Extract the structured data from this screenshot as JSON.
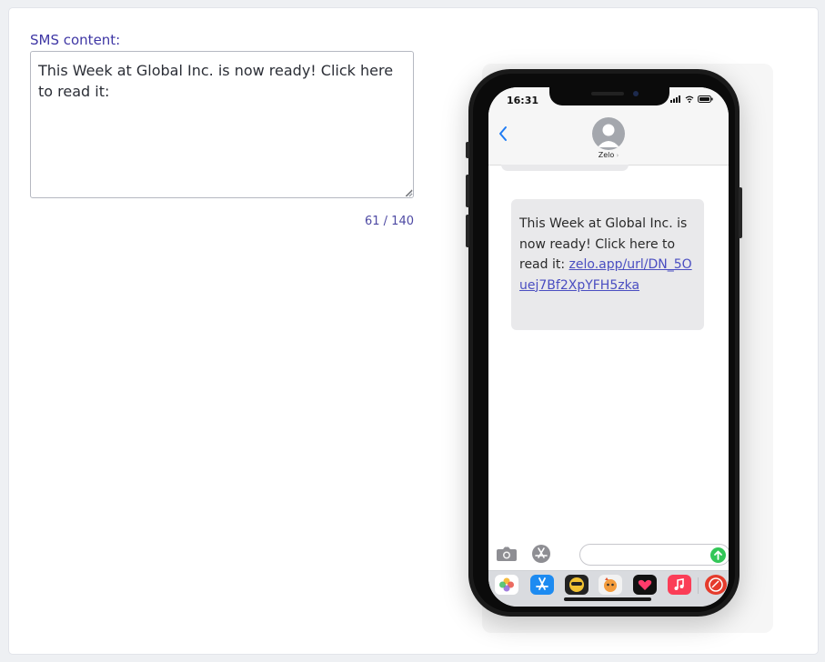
{
  "form": {
    "label": "SMS content:",
    "value": "This Week at Global Inc. is now ready! Click here to read it:",
    "counter": "61 / 140"
  },
  "phone": {
    "status_time": "16:31",
    "contact_name": "Zelo",
    "message_text": "This Week at Global Inc. is now ready! Click here to read it:",
    "message_link": "zelo.app/url/DN_5Ouej7Bf2XpYFH5zka"
  },
  "colors": {
    "label": "#3f37a5",
    "link": "#4a4ec1",
    "ios_blue": "#1f7cf4",
    "send_green": "#33c758"
  },
  "icons": {
    "back": "chevron-left-icon",
    "camera": "camera-icon",
    "app_store": "app-store-icon",
    "send": "send-arrow-icon"
  }
}
